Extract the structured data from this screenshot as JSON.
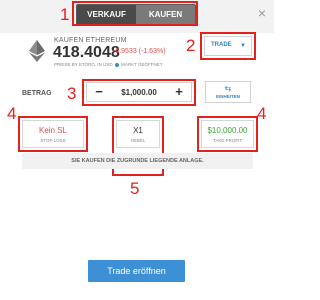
{
  "header": {
    "toggle": {
      "sell_label": "VERKAUF",
      "buy_label": "KAUFEN"
    },
    "close_icon": "close-icon"
  },
  "instrument": {
    "label": "KAUFEN ETHEREUM",
    "price": "418.4048",
    "change": "-6.9533 (-1.63%)",
    "source_text": "PREISE BY ETORO, IN USD",
    "market_status": "MARKT GEÖFFNET",
    "logo_icon": "ethereum-icon"
  },
  "trade_select": {
    "label": "TRADE",
    "chevron_icon": "chevron-down-icon"
  },
  "amount": {
    "label": "BETRAG",
    "minus": "−",
    "plus": "+",
    "value": "$1,000.00",
    "units_label": "EINHEITEN",
    "units_icon": "swap-arrows-icon"
  },
  "options": {
    "stop_loss": {
      "value": "Kein SL",
      "label": "STOP LOSS"
    },
    "leverage": {
      "value": "X1",
      "label": "HEBEL"
    },
    "take_profit": {
      "value": "$10,000.00",
      "label": "TAKE PROFIT"
    }
  },
  "disclaimer": "SIE KAUFEN DIE ZUGRUNDE LIEGENDE ANLAGE.",
  "submit_label": "Trade eröffnen",
  "annotations": {
    "n1": "1",
    "n2": "2",
    "n3": "3",
    "n4a": "4",
    "n4b": "4",
    "n5": "5"
  },
  "colors": {
    "accent_blue": "#3d8fd6",
    "annotation_red": "#e2221c",
    "loss_red": "#d9534f",
    "profit_green": "#3aa63a"
  }
}
